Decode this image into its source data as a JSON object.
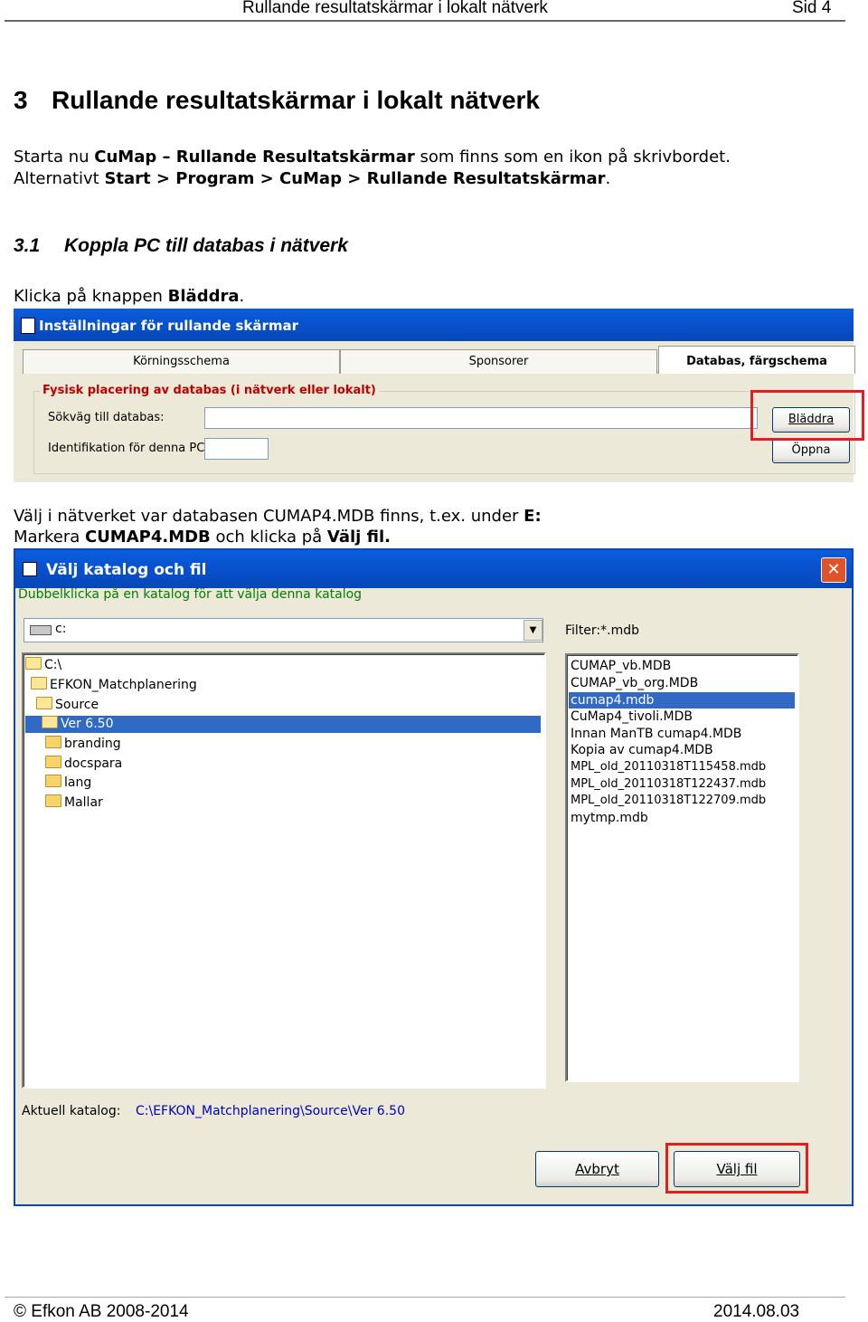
{
  "header": {
    "title": "Rullande resultatskärmar i lokalt nätverk",
    "page": "Sid 4"
  },
  "section": {
    "number": "3",
    "title": "Rullande resultatskärmar i lokalt nätverk"
  },
  "intro": {
    "p1_pre": "Starta nu ",
    "p1_bold": "CuMap – Rullande Resultatskärmar",
    "p1_post": " som finns som en ikon på skrivbordet.",
    "p2_pre": "Alternativt ",
    "p2_bold": "Start > Program > CuMap > Rullande Resultatskärmar",
    "p2_post": "."
  },
  "subsection": {
    "number": "3.1",
    "title": "Koppla PC till databas i nätverk"
  },
  "instr1": {
    "pre": "Klicka på knappen ",
    "bold": "Bläddra",
    "post": "."
  },
  "settings_window": {
    "title": "Inställningar för rullande skärmar",
    "tabs": [
      "Körningsschema",
      "Sponsorer",
      "Databas, färgschema"
    ],
    "group_label": "Fysisk placering av databas (i nätverk eller lokalt)",
    "path_label": "Sökväg till databas:",
    "id_label": "Identifikation för denna PC:",
    "browse_button": "Bläddra",
    "open_button": "Öppna"
  },
  "instr2": {
    "l1_pre": "Välj i nätverket var databasen CUMAP4.MDB finns, t.ex. under ",
    "l1_bold": "E:",
    "l2_pre": "Markera ",
    "l2_bold1": "CUMAP4.MDB",
    "l2_mid": " och klicka på ",
    "l2_bold2": "Välj fil."
  },
  "file_dialog": {
    "title": "Välj katalog och fil",
    "hint": "Dubbelklicka på en katalog för att välja denna katalog",
    "drive": "c:",
    "filter": "Filter:*.mdb",
    "folders": [
      {
        "name": "C:\\",
        "indent": 0,
        "open": true,
        "selected": false
      },
      {
        "name": "EFKON_Matchplanering",
        "indent": 1,
        "open": true,
        "selected": false
      },
      {
        "name": "Source",
        "indent": 2,
        "open": true,
        "selected": false
      },
      {
        "name": "Ver 6.50",
        "indent": 3,
        "open": true,
        "selected": true
      },
      {
        "name": "branding",
        "indent": 4,
        "open": false,
        "selected": false
      },
      {
        "name": "docspara",
        "indent": 4,
        "open": false,
        "selected": false
      },
      {
        "name": "lang",
        "indent": 4,
        "open": false,
        "selected": false
      },
      {
        "name": "Mallar",
        "indent": 4,
        "open": false,
        "selected": false
      }
    ],
    "files": [
      {
        "name": "CUMAP_vb.MDB",
        "selected": false
      },
      {
        "name": "CUMAP_vb_org.MDB",
        "selected": false
      },
      {
        "name": "cumap4.mdb",
        "selected": true
      },
      {
        "name": "CuMap4_tivoli.MDB",
        "selected": false
      },
      {
        "name": "Innan ManTB cumap4.MDB",
        "selected": false
      },
      {
        "name": "Kopia av cumap4.MDB",
        "selected": false
      },
      {
        "name": "MPL_old_20110318T115458.mdb",
        "selected": false
      },
      {
        "name": "MPL_old_20110318T122437.mdb",
        "selected": false
      },
      {
        "name": "MPL_old_20110318T122709.mdb",
        "selected": false
      },
      {
        "name": "mytmp.mdb",
        "selected": false
      }
    ],
    "current_label": "Aktuell katalog:",
    "current_path": "C:\\EFKON_Matchplanering\\Source\\Ver 6.50",
    "cancel_button": "Avbryt",
    "select_button": "Välj fil"
  },
  "footer": {
    "left": "© Efkon AB 2008-2014",
    "right": "2014.08.03"
  },
  "colors": {
    "highlight_red": "#e02020",
    "xp_blue": "#0853d0",
    "selection": "#316ac5"
  }
}
